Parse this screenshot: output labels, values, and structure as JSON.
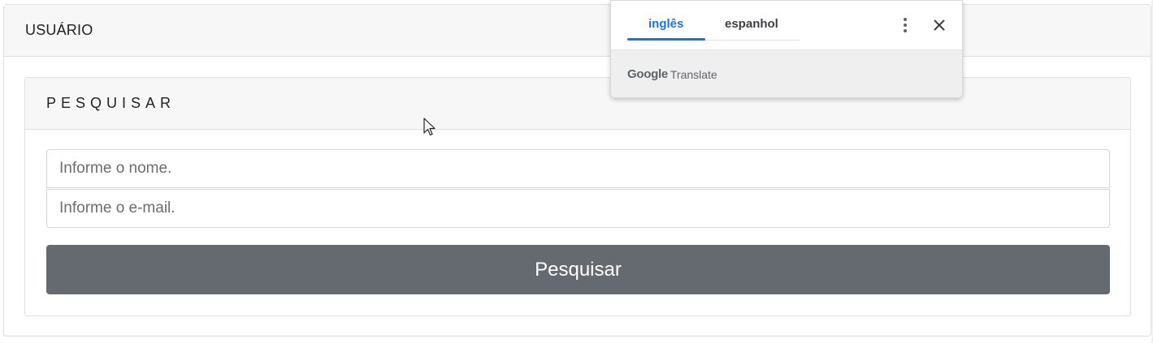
{
  "page": {
    "title": "USUÁRIO"
  },
  "search_panel": {
    "title": "PESQUISAR",
    "name_field": {
      "value": "",
      "placeholder": "Informe o nome."
    },
    "email_field": {
      "value": "",
      "placeholder": "Informe o e-mail."
    },
    "search_button_label": "Pesquisar",
    "button_color": "#656a71"
  },
  "translate_popup": {
    "tabs": [
      {
        "label": "inglês",
        "active": true
      },
      {
        "label": "espanhol",
        "active": false
      }
    ],
    "accent_color": "#1a73e8",
    "brand_google": "Google",
    "brand_translate": "Translate",
    "icons": {
      "more": "more-vert-icon",
      "close": "close-icon"
    }
  },
  "cursor": {
    "icon": "mouse-pointer-icon"
  }
}
